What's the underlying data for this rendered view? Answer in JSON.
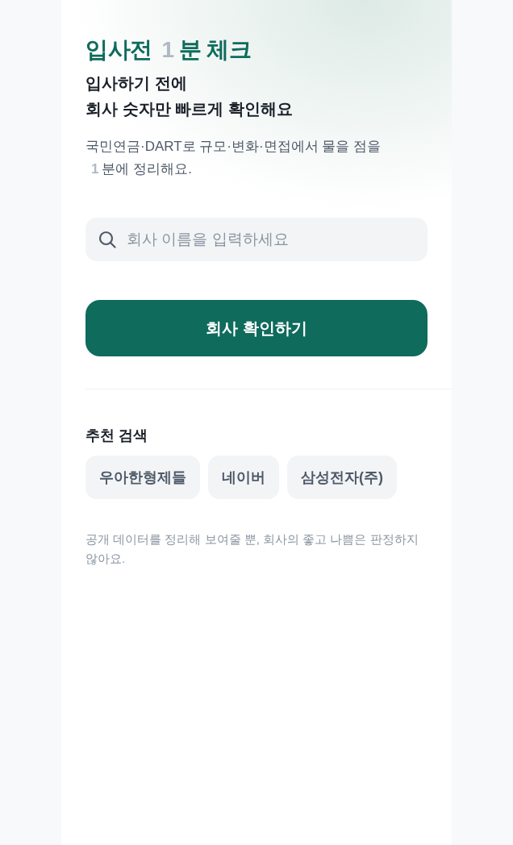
{
  "hero": {
    "title": {
      "before": "입사전",
      "count": "1",
      "after": "분 체크"
    },
    "subtitle_lines": [
      "입사하기 전에",
      "회사 숫자만 빠르게 확인해요"
    ],
    "description": {
      "before": "국민연금·DART로 규모·변화·면접에서 물을 점을",
      "count": "1",
      "after": "분에 정리해요."
    }
  },
  "search": {
    "placeholder": "회사 이름을 입력하세요"
  },
  "submit_button": {
    "label": "회사 확인하기"
  },
  "suggestions": {
    "heading": "추천 검색",
    "chips": [
      "우아한형제들",
      "네이버",
      "삼성전자(주)"
    ]
  },
  "disclaimer": "공개 데이터를 정리해 보여줄 뿐, 회사의 좋고 나쁨은 판정하지 않아요."
}
